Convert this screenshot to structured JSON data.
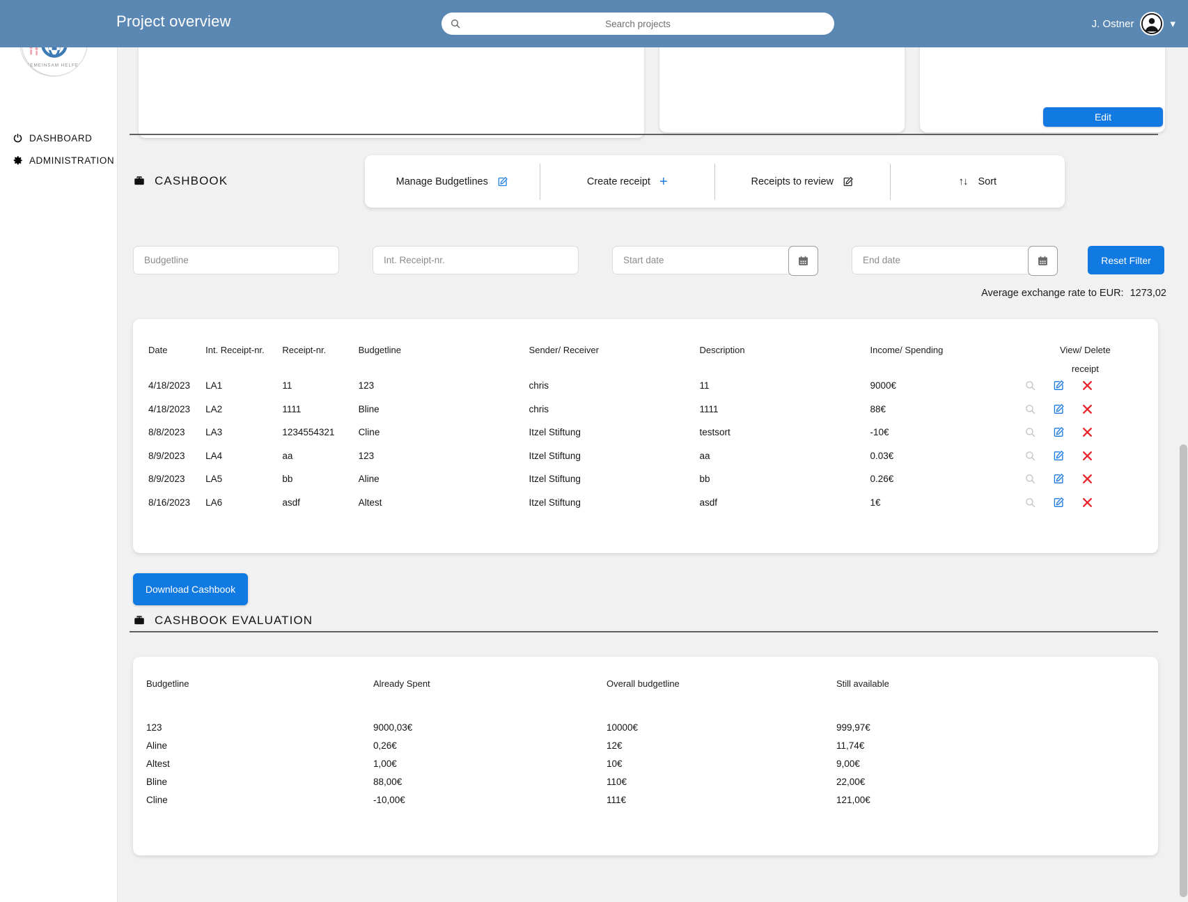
{
  "header": {
    "title": "Project overview",
    "search": {
      "placeholder": "Search projects",
      "value": ""
    },
    "user_name": "J. Ostner",
    "logo_alt": "Lands Aid"
  },
  "sidebar": {
    "items": [
      {
        "label": "DASHBOARD",
        "icon": "power-circle-icon"
      },
      {
        "label": "ADMINISTRATION",
        "icon": "gear-icon"
      }
    ]
  },
  "main": {
    "edit_button": "Edit"
  },
  "cashbook": {
    "section_title": "CASHBOOK",
    "toolbar": [
      {
        "label": "Manage Budgetlines",
        "icon": "edit-square-icon"
      },
      {
        "label": "Create receipt",
        "icon": "plus-icon"
      },
      {
        "label": "Receipts to review",
        "icon": "edit-square-icon"
      },
      {
        "label": "Sort",
        "icon": "sort-arrows-icon"
      }
    ],
    "filters": {
      "budgetline_placeholder": "Budgetline",
      "budgetline_value": "",
      "int_receipt_placeholder": "Int. Receipt-nr.",
      "int_receipt_value": "",
      "start_date_placeholder": "Start date",
      "start_date_value": "",
      "end_date_placeholder": "End date",
      "end_date_value": "",
      "reset_button": "Reset Filter"
    },
    "exchange_rate_label": "Average exchange rate to EUR:",
    "exchange_rate_value": "1273,02",
    "columns": [
      "Date",
      "Int. Receipt-nr.",
      "Receipt-nr.",
      "Budgetline",
      "Sender/ Receiver",
      "Description",
      "Income/ Spending",
      "View/ Delete",
      "receipt"
    ],
    "rows": [
      {
        "date": "4/18/2023",
        "int_receipt_nr": "LA1",
        "receipt_nr": "11",
        "budgetline": "123",
        "sender_receiver": "chris",
        "description": "11",
        "amount": "9000€"
      },
      {
        "date": "4/18/2023",
        "int_receipt_nr": "LA2",
        "receipt_nr": "1111",
        "budgetline": "Bline",
        "sender_receiver": "chris",
        "description": "1111",
        "amount": "88€"
      },
      {
        "date": "8/8/2023",
        "int_receipt_nr": "LA3",
        "receipt_nr": "1234554321",
        "budgetline": "Cline",
        "sender_receiver": "Itzel Stiftung",
        "description": "testsort",
        "amount": "-10€"
      },
      {
        "date": "8/9/2023",
        "int_receipt_nr": "LA4",
        "receipt_nr": "aa",
        "budgetline": "123",
        "sender_receiver": "Itzel Stiftung",
        "description": "aa",
        "amount": "0.03€"
      },
      {
        "date": "8/9/2023",
        "int_receipt_nr": "LA5",
        "receipt_nr": "bb",
        "budgetline": "Aline",
        "sender_receiver": "Itzel Stiftung",
        "description": "bb",
        "amount": "0.26€"
      },
      {
        "date": "8/16/2023",
        "int_receipt_nr": "LA6",
        "receipt_nr": "asdf",
        "budgetline": "Altest",
        "sender_receiver": "Itzel Stiftung",
        "description": "asdf",
        "amount": "1€"
      }
    ],
    "download_button": "Download Cashbook"
  },
  "evaluation": {
    "section_title": "CASHBOOK EVALUATION",
    "columns": [
      "Budgetline",
      "Already Spent",
      "Overall budgetline",
      "Still available"
    ],
    "rows": [
      {
        "budgetline": "123",
        "already_spent": "9000,03€",
        "overall": "10000€",
        "available": "999,97€"
      },
      {
        "budgetline": "Aline",
        "already_spent": "0,26€",
        "overall": "12€",
        "available": "11,74€"
      },
      {
        "budgetline": "Altest",
        "already_spent": "1,00€",
        "overall": "10€",
        "available": "9,00€"
      },
      {
        "budgetline": "Bline",
        "already_spent": "88,00€",
        "overall": "110€",
        "available": "22,00€"
      },
      {
        "budgetline": "Cline",
        "already_spent": "-10,00€",
        "overall": "111€",
        "available": "121,00€"
      }
    ]
  },
  "colors": {
    "header_blue": "#5b88b3",
    "accent_blue": "#1079e2",
    "icon_blue": "#1d7ae0",
    "delete_red": "#e8232a",
    "page_bg": "#f1f1f1"
  }
}
